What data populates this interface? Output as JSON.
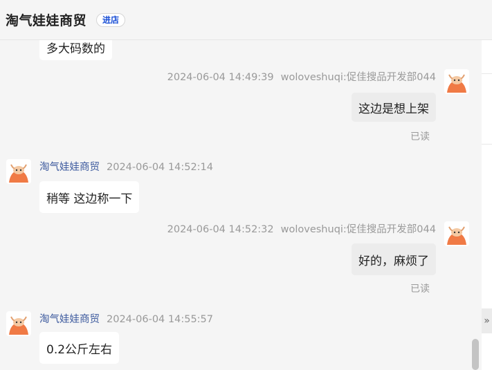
{
  "header": {
    "shop_name": "淘气娃娃商贸",
    "enter_shop_label": "进店"
  },
  "messages": [
    {
      "text": "多大码数的"
    },
    {
      "time": "2024-06-04 14:49:39",
      "sender": "woloveshuqi:促佳搜品开发部044",
      "text": "这边是想上架",
      "status": "已读"
    },
    {
      "sender": "淘气娃娃商贸",
      "time": "2024-06-04 14:52:14",
      "text": "稍等 这边称一下"
    },
    {
      "time": "2024-06-04 14:52:32",
      "sender": "woloveshuqi:促佳搜品开发部044",
      "text": "好的，麻烦了",
      "status": "已读"
    },
    {
      "sender": "淘气娃娃商贸",
      "time": "2024-06-04 14:55:57",
      "text": "0.2公斤左右"
    }
  ],
  "side": {
    "collapse_icon": "»"
  },
  "colors": {
    "avatar_face": "#f07a45",
    "avatar_horn": "#f4c9a3",
    "link_name": "#3d5a9e",
    "accent": "#1a4fd6"
  }
}
